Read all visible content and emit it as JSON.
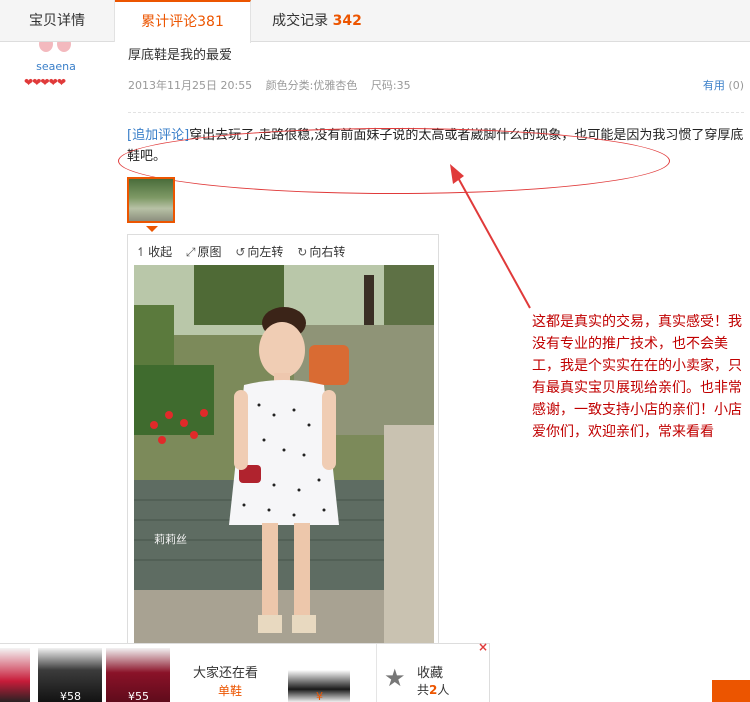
{
  "tabs": [
    {
      "label": "宝贝详情",
      "count": ""
    },
    {
      "label": "累计评论",
      "count": "381"
    },
    {
      "label": "成交记录",
      "count": "342"
    }
  ],
  "reviewer": {
    "name": "seaena",
    "rank_hearts": "❤❤❤❤❤"
  },
  "review": {
    "text": "厚底鞋是我的最爱",
    "date": "2013年11月25日 20:55",
    "color_class": "颜色分类:优雅杏色",
    "size": "尺码:35",
    "useful_label": "有用",
    "useful_count": "(0)"
  },
  "append": {
    "tag": "[追加评论]",
    "text": "穿出去玩了,走路很稳,没有前面妹子说的太高或者崴脚什么的现象，也可能是因为我习惯了穿厚底鞋吧。"
  },
  "viewer": {
    "collapse": "收起",
    "original": "原图",
    "rotate_left": "向左转",
    "rotate_right": "向右转",
    "watermark": "莉莉丝"
  },
  "annotation": "这都是真实的交易，真实感受！我没有专业的推广技术，也不会美工，我是个实实在在的小卖家，只有最真实宝贝展现给亲们。也非常感谢，一致支持小店的亲们！小店爱你们，欢迎亲们，常来看看",
  "bottom_bar": {
    "price1": "¥58",
    "price2": "¥55",
    "everyone_label": "大家还在看",
    "single_label": "单鞋",
    "price3": "¥",
    "fav_label": "收藏",
    "fav_prefix": "共",
    "fav_count": "2",
    "fav_suffix": "人",
    "close": "×"
  },
  "colors": {
    "accent": "#ec5500",
    "link": "#3a7fc9",
    "annotation": "#c00000"
  }
}
